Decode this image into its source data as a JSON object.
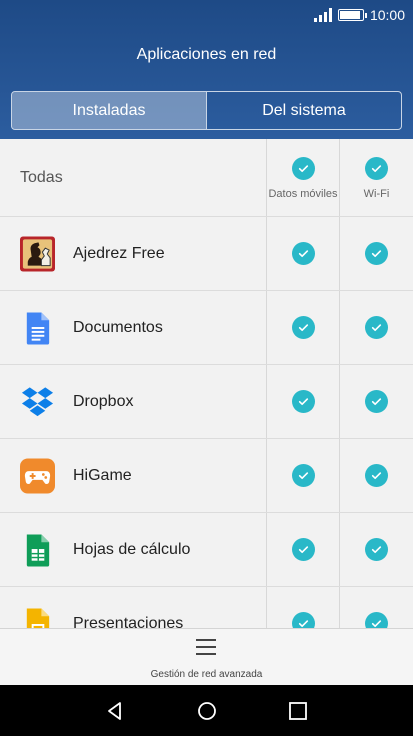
{
  "status_bar": {
    "time": "10:00"
  },
  "header": {
    "title": "Aplicaciones en red"
  },
  "tabs": [
    {
      "label": "Instaladas",
      "active": true
    },
    {
      "label": "Del sistema",
      "active": false
    }
  ],
  "list_header": {
    "all_label": "Todas",
    "col_mobile": "Datos móviles",
    "col_wifi": "Wi-Fi"
  },
  "apps": [
    {
      "name": "Ajedrez Free",
      "icon": "chess-app-icon",
      "mobile_data": true,
      "wifi": true
    },
    {
      "name": "Documentos",
      "icon": "docs-app-icon",
      "mobile_data": true,
      "wifi": true
    },
    {
      "name": "Dropbox",
      "icon": "dropbox-app-icon",
      "mobile_data": true,
      "wifi": true
    },
    {
      "name": "HiGame",
      "icon": "higame-app-icon",
      "mobile_data": true,
      "wifi": true
    },
    {
      "name": "Hojas de cálculo",
      "icon": "sheets-app-icon",
      "mobile_data": true,
      "wifi": true
    },
    {
      "name": "Presentaciones",
      "icon": "slides-app-icon",
      "mobile_data": true,
      "wifi": true
    }
  ],
  "bottom_bar": {
    "label": "Gestión de red avanzada"
  },
  "colors": {
    "header": "#1e4a86",
    "check": "#29b8c8"
  }
}
